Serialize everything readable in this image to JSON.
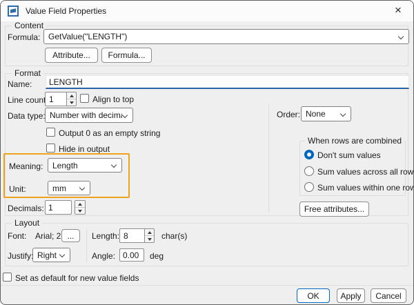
{
  "window": {
    "title": "Value Field Properties",
    "close_glyph": "×"
  },
  "content": {
    "group_label": "Content",
    "formula_label": "Formula:",
    "formula_value": "GetValue(\"LENGTH\")",
    "attribute_button": "Attribute...",
    "formula_button": "Formula..."
  },
  "format": {
    "group_label": "Format",
    "name_label": "Name:",
    "name_value": "LENGTH",
    "line_count_label": "Line count",
    "line_count_value": "1",
    "align_to_top_label": "Align to top",
    "data_type_label": "Data type:",
    "data_type_value": "Number with decimals",
    "output_zero_label": "Output 0 as an empty string",
    "hide_in_output_label": "Hide in output",
    "meaning_label": "Meaning:",
    "meaning_value": "Length",
    "unit_label": "Unit:",
    "unit_value": "mm",
    "decimals_label": "Decimals:",
    "decimals_value": "1",
    "order_label": "Order:",
    "order_value": "None",
    "combine_group_label": "When rows are combined",
    "combine_options": [
      {
        "label": "Don't sum values",
        "selected": true
      },
      {
        "label": "Sum values across all rows",
        "selected": false
      },
      {
        "label": "Sum values within one row",
        "selected": false
      }
    ],
    "free_attributes_button": "Free attributes..."
  },
  "layout_section": {
    "group_label": "Layout",
    "font_label": "Font:",
    "font_value": "Arial; 2",
    "font_browse_button": "...",
    "justify_label": "Justify:",
    "justify_value": "Right",
    "length_label": "Length:",
    "length_value": "8",
    "length_unit": "char(s)",
    "angle_label": "Angle:",
    "angle_value": "0.00",
    "angle_unit": "deg"
  },
  "footer": {
    "default_checkbox_label": "Set as default for new value fields",
    "ok_button": "OK",
    "apply_button": "Apply",
    "cancel_button": "Cancel"
  },
  "colors": {
    "accent_blue": "#0067c0",
    "name_underline_blue": "#2a5fad",
    "highlight_orange": "#eda11d",
    "dialog_background": "#efefef"
  }
}
